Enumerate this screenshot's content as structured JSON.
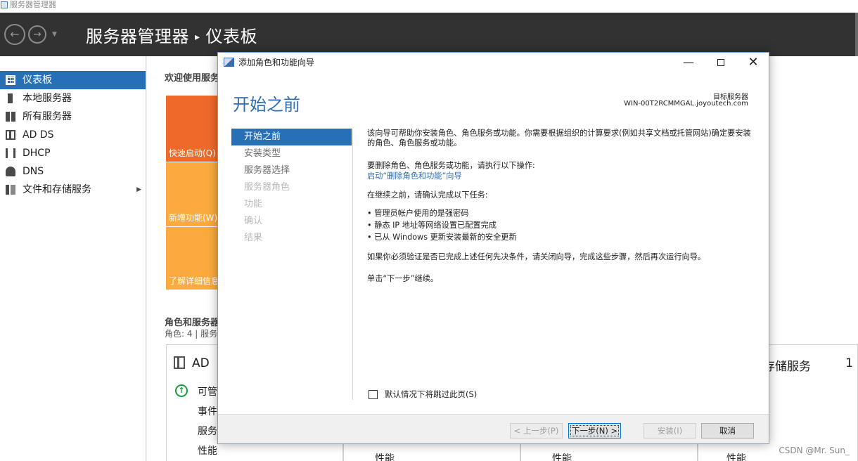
{
  "window": {
    "title": "服务器管理器"
  },
  "header": {
    "app": "服务器管理器",
    "separator": "▸",
    "page": "仪表板"
  },
  "sidebar": {
    "items": [
      {
        "label": "仪表板"
      },
      {
        "label": "本地服务器"
      },
      {
        "label": "所有服务器"
      },
      {
        "label": "AD DS"
      },
      {
        "label": "DHCP"
      },
      {
        "label": "DNS"
      },
      {
        "label": "文件和存储服务"
      }
    ]
  },
  "main": {
    "welcome": "欢迎使用服务",
    "tiles": {
      "quick": "快速启动(Q)",
      "new": "新增功能(W)",
      "learn": "了解详细信息"
    },
    "roles_title": "角色和服务器",
    "roles_sub": "角色: 4 | 服务器",
    "card_ad": {
      "title": "AD",
      "rows": [
        "可管",
        "事件",
        "服务",
        "性能"
      ]
    },
    "card_2": {
      "perf": "性能"
    },
    "card_3": {
      "perf": "性能"
    },
    "card_4": {
      "title": "存储服务",
      "count": "1",
      "perf": "性能"
    },
    "watermark": "CSDN @Mr. Sun_"
  },
  "dialog": {
    "title": "添加角色和功能向导",
    "heading": "开始之前",
    "target_label": "目标服务器",
    "target_value": "WIN-00T2RCMMGAL.joyoutech.com",
    "steps": [
      {
        "label": "开始之前",
        "state": "current"
      },
      {
        "label": "安装类型",
        "state": "normal"
      },
      {
        "label": "服务器选择",
        "state": "normal"
      },
      {
        "label": "服务器角色",
        "state": "disabled"
      },
      {
        "label": "功能",
        "state": "disabled"
      },
      {
        "label": "确认",
        "state": "disabled"
      },
      {
        "label": "结果",
        "state": "disabled"
      }
    ],
    "p1": "该向导可帮助你安装角色、角色服务或功能。你需要根据组织的计算要求(例如共享文档或托管网站)确定要安装的角色、角色服务或功能。",
    "p2": "要删除角色、角色服务或功能，请执行以下操作:",
    "p2_link": "启动“删除角色和功能”向导",
    "p3": "在继续之前，请确认完成以下任务:",
    "bullets": [
      "• 管理员帐户使用的是强密码",
      "• 静态 IP 地址等网络设置已配置完成",
      "• 已从 Windows 更新安装最新的安全更新"
    ],
    "p4": "如果你必须验证是否已完成上述任何先决条件，请关闭向导，完成这些步骤，然后再次运行向导。",
    "p5": "单击“下一步”继续。",
    "skip_label": "默认情况下将跳过此页(S)",
    "buttons": {
      "prev": "< 上一步(P)",
      "next": "下一步(N) >",
      "install": "安装(I)",
      "cancel": "取消"
    }
  },
  "icons": [
    "back-arrow-icon",
    "forward-arrow-icon",
    "dashboard-grid-icon",
    "server-icon",
    "servers-icon",
    "ad-ds-icon",
    "dhcp-icon",
    "dns-icon",
    "file-storage-icon",
    "wizard-icon",
    "success-up-arrow-icon"
  ],
  "colors": {
    "accent": "#2770b8",
    "banner": "#323232",
    "tile_orange": "#ef6a2a",
    "tile_yellow": "#fbab3d",
    "heading_blue": "#2e6db4"
  }
}
